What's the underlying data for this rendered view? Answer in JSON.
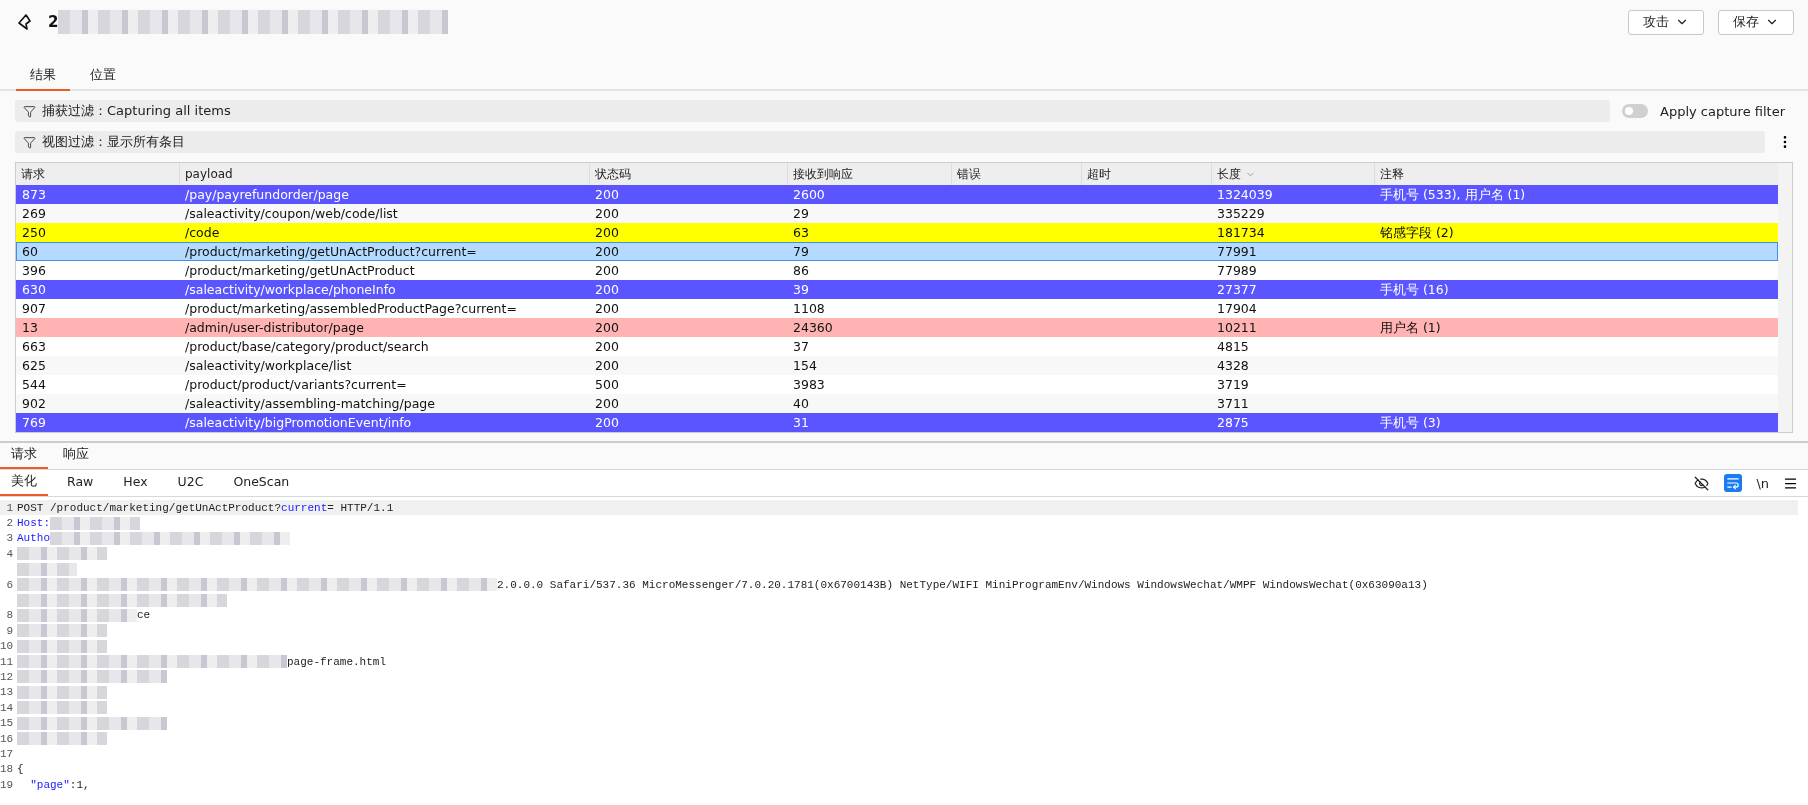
{
  "header": {
    "title": "2",
    "buttons": [
      {
        "label": "攻击"
      },
      {
        "label": "保存"
      }
    ]
  },
  "tabs": [
    {
      "label": "结果",
      "selected": true
    },
    {
      "label": "位置",
      "selected": false
    }
  ],
  "capture_filter": {
    "text": "捕获过滤：Capturing all items",
    "toggle": {
      "label": "Apply capture filter",
      "on": false
    }
  },
  "view_filter": {
    "text": "视图过滤：显示所有条目"
  },
  "table": {
    "columns": [
      {
        "label": "请求"
      },
      {
        "label": "payload"
      },
      {
        "label": "状态码"
      },
      {
        "label": "接收到响应"
      },
      {
        "label": "错误"
      },
      {
        "label": "超时"
      },
      {
        "label": "长度",
        "sorted": true
      },
      {
        "label": "注释"
      }
    ],
    "rows": [
      {
        "cells": [
          "873",
          "/pay/payrefundorder/page",
          "200",
          "2600",
          "",
          "",
          "1324039",
          "手机号 (533), 用户名 (1)"
        ],
        "color": "#5b55ff",
        "selected": false
      },
      {
        "cells": [
          "269",
          "/saleactivity/coupon/web/code/list",
          "200",
          "29",
          "",
          "",
          "335229",
          ""
        ],
        "selected": false
      },
      {
        "cells": [
          "250",
          "/code",
          "200",
          "63",
          "",
          "",
          "181734",
          "铭感字段 (2)"
        ],
        "color": "#ffff00",
        "selected": false
      },
      {
        "cells": [
          "60",
          "/product/marketing/getUnActProduct?current=",
          "200",
          "79",
          "",
          "",
          "77991",
          ""
        ],
        "selected": true
      },
      {
        "cells": [
          "396",
          "/product/marketing/getUnActProduct",
          "200",
          "86",
          "",
          "",
          "77989",
          ""
        ],
        "selected": false
      },
      {
        "cells": [
          "630",
          "/saleactivity/workplace/phoneInfo",
          "200",
          "39",
          "",
          "",
          "27377",
          "手机号 (16)"
        ],
        "color": "#5b55ff",
        "selected": false
      },
      {
        "cells": [
          "907",
          "/product/marketing/assembledProductPage?current=",
          "200",
          "1108",
          "",
          "",
          "17904",
          ""
        ],
        "selected": false
      },
      {
        "cells": [
          "13",
          "/admin/user-distributor/page",
          "200",
          "24360",
          "",
          "",
          "10211",
          "用户名 (1)"
        ],
        "color": "#ffb3b3",
        "selected": false
      },
      {
        "cells": [
          "663",
          "/product/base/category/product/search",
          "200",
          "37",
          "",
          "",
          "4815",
          ""
        ],
        "selected": false
      },
      {
        "cells": [
          "625",
          "/saleactivity/workplace/list",
          "200",
          "154",
          "",
          "",
          "4328",
          ""
        ],
        "selected": false
      },
      {
        "cells": [
          "544",
          "/product/product/variants?current=",
          "500",
          "3983",
          "",
          "",
          "3719",
          ""
        ],
        "selected": false
      },
      {
        "cells": [
          "902",
          "/saleactivity/assembling-matching/page",
          "200",
          "40",
          "",
          "",
          "3711",
          ""
        ],
        "selected": false
      },
      {
        "cells": [
          "769",
          "/saleactivity/bigPromotionEvent/info",
          "200",
          "31",
          "",
          "",
          "2875",
          "手机号 (3)"
        ],
        "color": "#5b55ff",
        "selected": false
      }
    ]
  },
  "message_tabs": [
    {
      "label": "请求",
      "selected": true
    },
    {
      "label": "响应",
      "selected": false
    }
  ],
  "view_tabs": [
    {
      "label": "美化",
      "selected": true
    },
    {
      "label": "Raw",
      "selected": false
    },
    {
      "label": "Hex",
      "selected": false
    },
    {
      "label": "U2C",
      "selected": false
    },
    {
      "label": "OneScan",
      "selected": false
    }
  ],
  "editor_tools": {
    "hide_on": false,
    "wrap_on": true,
    "newline": "\\n"
  },
  "code_lines": [
    {
      "number": "1",
      "tokens": [
        {
          "kind": "plain",
          "text": "POST /product/marketing/getUnActProduct?"
        },
        {
          "kind": "key",
          "text": "current"
        },
        {
          "kind": "plain",
          "text": "= HTTP/1.1"
        }
      ]
    },
    {
      "number": "2",
      "tokens": [
        {
          "kind": "key",
          "text": "Host:"
        },
        {
          "kind": "mosaic"
        }
      ]
    },
    {
      "number": "3",
      "tokens": [
        {
          "kind": "key",
          "text": "Autho"
        },
        {
          "kind": "mosaic"
        }
      ]
    },
    {
      "number": "4",
      "tokens": [
        {
          "kind": "mosaic"
        }
      ]
    },
    {
      "tokens": [
        {
          "kind": "mosaic"
        }
      ]
    },
    {
      "number": "6",
      "tokens": [
        {
          "kind": "mosaic"
        },
        {
          "kind": "plain",
          "text": "2.0.0.0 Safari/537.36 MicroMessenger/7.0.20.1781(0x6700143B) NetType/WIFI MiniProgramEnv/Windows WindowsWechat/WMPF WindowsWechat(0x63090a13)"
        }
      ]
    },
    {
      "tokens": [
        {
          "kind": "mosaic"
        }
      ]
    },
    {
      "number": "8",
      "tokens": [
        {
          "kind": "mosaic"
        },
        {
          "kind": "plain",
          "text": "ce"
        }
      ]
    },
    {
      "number": "9",
      "tokens": [
        {
          "kind": "mosaic"
        }
      ]
    },
    {
      "number": "10",
      "tokens": [
        {
          "kind": "mosaic"
        }
      ]
    },
    {
      "number": "11",
      "tokens": [
        {
          "kind": "mosaic"
        },
        {
          "kind": "plain",
          "text": "page-frame.html"
        }
      ]
    },
    {
      "number": "12",
      "tokens": [
        {
          "kind": "mosaic"
        }
      ]
    },
    {
      "number": "13",
      "tokens": [
        {
          "kind": "mosaic"
        }
      ]
    },
    {
      "number": "14",
      "tokens": [
        {
          "kind": "mosaic"
        }
      ]
    },
    {
      "number": "15",
      "tokens": [
        {
          "kind": "mosaic"
        }
      ]
    },
    {
      "number": "16",
      "tokens": [
        {
          "kind": "mosaic"
        }
      ]
    },
    {
      "number": "17"
    },
    {
      "number": "18",
      "tokens": [
        {
          "kind": "plain",
          "text": "{"
        }
      ]
    },
    {
      "number": "19",
      "tokens": [
        {
          "kind": "key",
          "text": "  \"page\""
        },
        {
          "kind": "plain",
          "text": ":1,"
        }
      ]
    }
  ]
}
